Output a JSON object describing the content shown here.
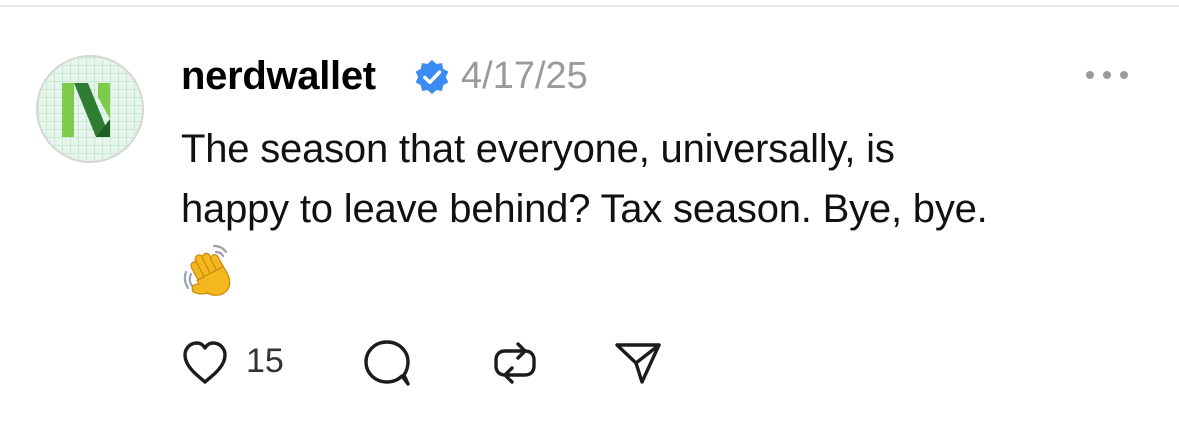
{
  "post": {
    "username": "nerdwallet",
    "verified": true,
    "date": "4/17/25",
    "text_line_1": "The season that everyone, universally, is",
    "text_line_2": "happy to leave behind? Tax season. Bye, bye.",
    "emoji": "waving-hand-emoji"
  },
  "actions": {
    "like_count": "15"
  },
  "icons": {
    "avatar_logo": "nerdwallet-logo",
    "verified": "verified-badge-icon",
    "more": "more-options-icon",
    "like": "heart-icon",
    "reply": "comment-icon",
    "repost": "repost-icon",
    "share": "send-icon"
  },
  "colors": {
    "verified_blue": "#3b8cf2",
    "logo_green_dark": "#2e7d32",
    "logo_green_light": "#7ccb4a",
    "avatar_bg": "#e7f6ec",
    "muted_text": "#9a9a9a"
  }
}
